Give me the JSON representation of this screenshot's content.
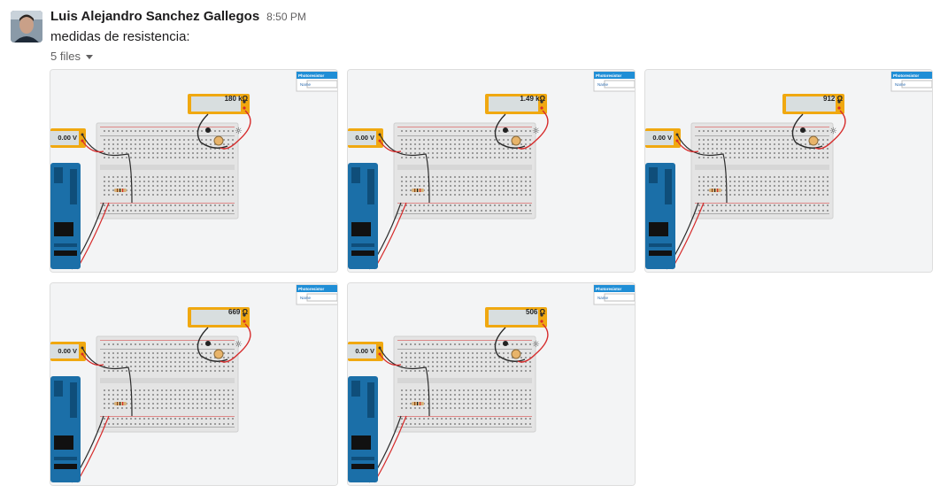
{
  "message": {
    "author": "Luis Alejandro Sanchez Gallegos",
    "time": "8:50 PM",
    "text": "medidas de resistencia:",
    "files_label": "5 files"
  },
  "panel": {
    "title": "Photoresistor",
    "name_label": "Name"
  },
  "voltmeter_reading": "0.00 V",
  "attachments": [
    {
      "reading": "180 kΩ"
    },
    {
      "reading": "1.49 kΩ"
    },
    {
      "reading": "912 Ω"
    },
    {
      "reading": "669 Ω"
    },
    {
      "reading": "506 Ω"
    }
  ],
  "colors": {
    "multimeter": "#f0a810",
    "arduino": "#1b6fa8",
    "wire_red": "#d62b2b",
    "wire_black": "#2b2b2b",
    "panel_header": "#1f8ed6"
  }
}
